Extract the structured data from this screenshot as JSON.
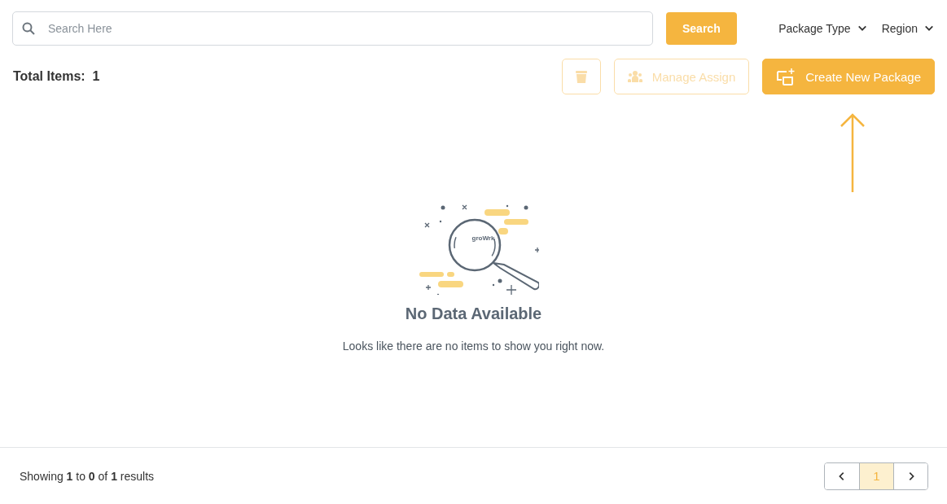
{
  "search": {
    "placeholder": "Search Here",
    "button": "Search"
  },
  "filters": [
    {
      "label": "Package Type"
    },
    {
      "label": "Region"
    }
  ],
  "total": {
    "label": "Total Items:",
    "value": "1"
  },
  "actions": [
    {
      "kind": "delete",
      "disabled": true
    },
    {
      "kind": "assign",
      "label": "Manage Assign",
      "disabled": true
    },
    {
      "kind": "create",
      "label": "Create New Package",
      "disabled": false
    }
  ],
  "empty_state": {
    "logo_text": "groWrk",
    "title": "No Data Available",
    "message": "Looks like there are no items to show you right now."
  },
  "footer": {
    "summary": "Showing **1** to **0** of **1** results",
    "pages": [
      {
        "label": "1",
        "selected": true
      }
    ]
  }
}
